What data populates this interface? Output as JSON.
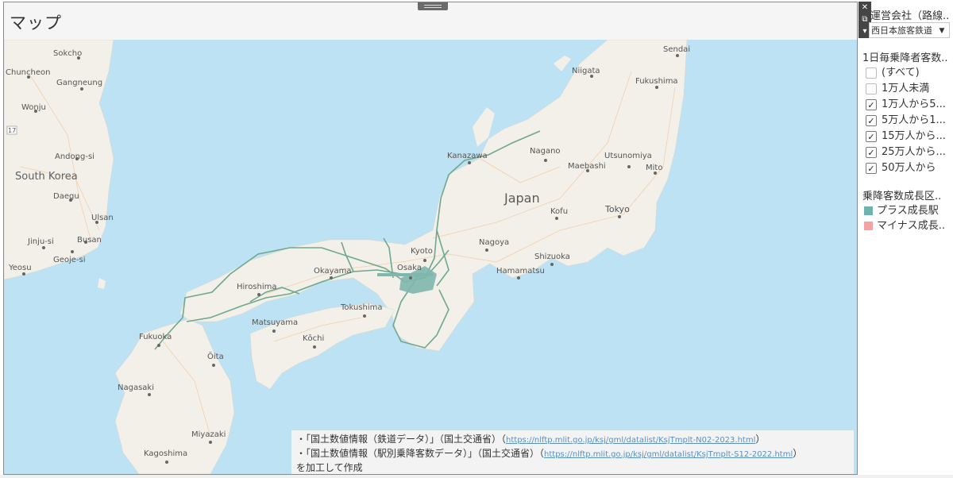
{
  "sheet": {
    "title": "マップ"
  },
  "map": {
    "colors": {
      "sea": "#bde2f4",
      "land": "#f2f0e8",
      "route": "#6ea88e",
      "road": "#f2c7a0"
    },
    "labels": {
      "sokcho": "Sokcho",
      "chuncheon": "Chuncheon",
      "gangneung": "Gangneung",
      "wonju": "Wonju",
      "road_number": "17",
      "andong": "Andong-si",
      "south_korea": "South Korea",
      "daegu": "Daegu",
      "ulsan": "Ulsan",
      "jinju": "Jinju-si",
      "busan": "Busan",
      "geoje": "Geoje-si",
      "yeosu": "Yeosu",
      "sendai": "Sendai",
      "niigata": "Niigata",
      "fukushima": "Fukushima",
      "kanazawa": "Kanazawa",
      "nagano": "Nagano",
      "utsunomiya": "Utsunomiya",
      "maebashi": "Maebashi",
      "mito": "Mito",
      "japan": "Japan",
      "kofu": "Kofu",
      "tokyo": "Tokyo",
      "kyoto": "Kyoto",
      "nagoya": "Nagoya",
      "shizuoka": "Shizuoka",
      "hamamatsu": "Hamamatsu",
      "osaka": "Osaka",
      "okayama": "Okayama",
      "hiroshima": "Hiroshima",
      "tokushima": "Tokushima",
      "matsuyama": "Matsuyama",
      "kochi": "Kōchi",
      "fukuoka": "Fukuoka",
      "oita": "Ōita",
      "nagasaki": "Nagasaki",
      "miyazaki": "Miyazaki",
      "kagoshima": "Kagoshima"
    }
  },
  "source_note": {
    "line1_text": "・「国土数値情報（鉄道データ）」（国土交通省）（",
    "line1_link": "https://nlftp.mlit.go.jp/ksj/gml/datalist/KsjTmplt-N02-2023.html",
    "line1_close": "）",
    "line2_text": "・「国土数値情報（駅別乗降客数データ）」（国土交通省）（",
    "line2_link": "https://nlftp.mlit.go.jp/ksj/gml/datalist/KsjTmplt-S12-2022.html",
    "line2_close": "）",
    "line3_text": "を加工して作成"
  },
  "toolbar": {
    "close_icon": "✕",
    "popout_icon": "⧉",
    "menu_icon": "▾"
  },
  "filters": {
    "operator": {
      "title": "運営会社（路線..",
      "selected": "西日本旅客鉄道",
      "arrow": "▼"
    },
    "daily_passengers": {
      "title": "1日毎乗降者客数..",
      "options": [
        {
          "label": "(すべて)",
          "checked": false,
          "mark": ""
        },
        {
          "label": "1万人未満",
          "checked": false,
          "mark": ""
        },
        {
          "label": "1万人から5...",
          "checked": true,
          "mark": "✓"
        },
        {
          "label": "5万人から1...",
          "checked": true,
          "mark": "✓"
        },
        {
          "label": "15万人から...",
          "checked": true,
          "mark": "✓"
        },
        {
          "label": "25万人から...",
          "checked": true,
          "mark": "✓"
        },
        {
          "label": "50万人から",
          "checked": true,
          "mark": "✓"
        }
      ]
    }
  },
  "legend": {
    "title": "乗降客数成長区..",
    "items": [
      {
        "label": "プラス成長駅",
        "color": "#6fb3ad"
      },
      {
        "label": "マイナス成長..",
        "color": "#f4a3a3"
      }
    ]
  }
}
